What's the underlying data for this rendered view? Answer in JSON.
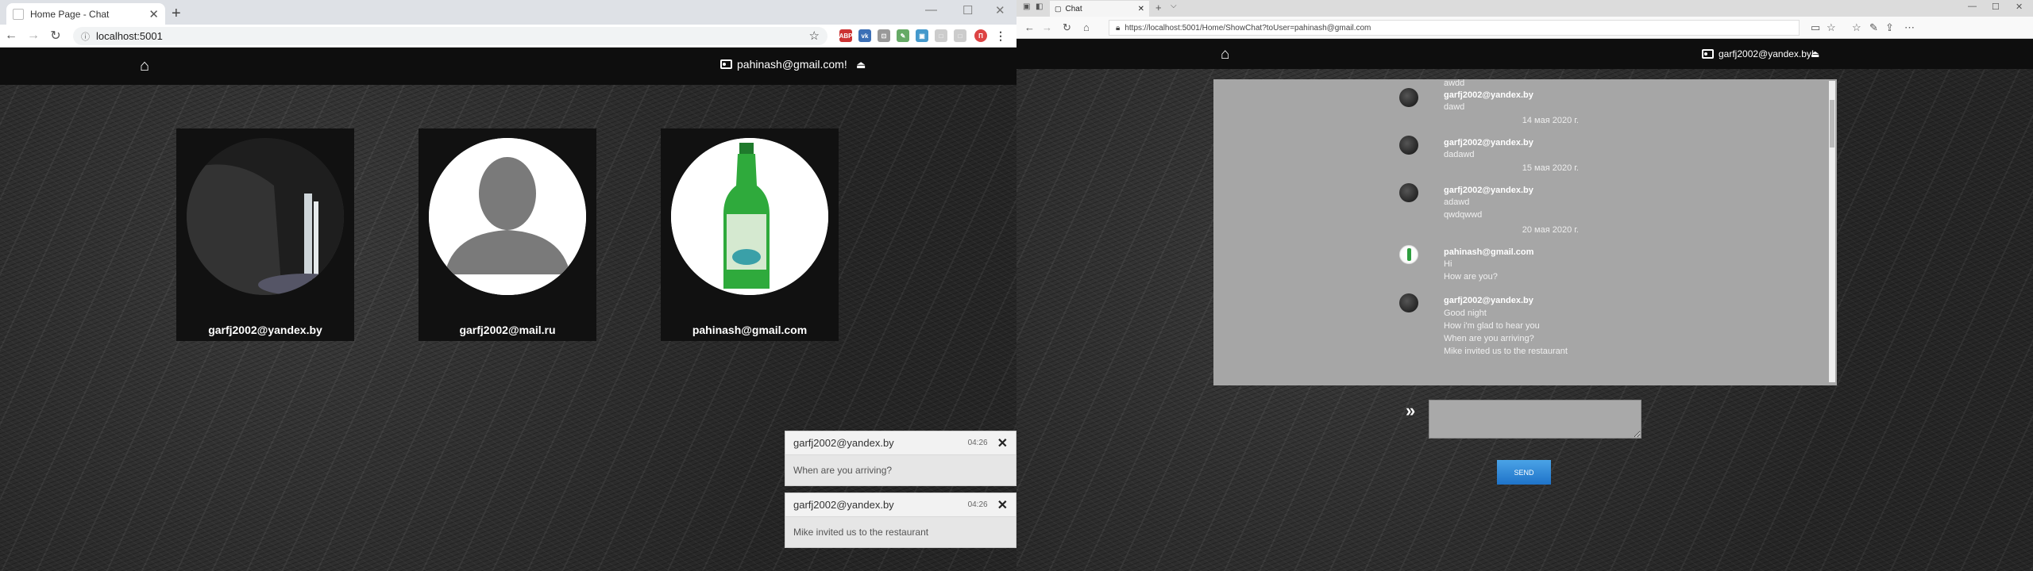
{
  "left_window": {
    "tab": {
      "title": "Home Page - Chat"
    },
    "address": {
      "url": "localhost:5001"
    },
    "navbar": {
      "home_icon": "home-icon",
      "greeting": "pahinash@gmail.com!",
      "logout_icon": "logout-icon"
    },
    "users": [
      {
        "email": "garfj2002@yandex.by",
        "avatar": "waterfall-photo"
      },
      {
        "email": "garfj2002@mail.ru",
        "avatar": "default-person-silhouette"
      },
      {
        "email": "pahinash@gmail.com",
        "avatar": "green-bottle-photo"
      }
    ],
    "notifications": [
      {
        "sender": "garfj2002@yandex.by",
        "time": "04:26",
        "message": "When are you arriving?"
      },
      {
        "sender": "garfj2002@yandex.by",
        "time": "04:26",
        "message": "Mike invited us to the restaurant"
      }
    ]
  },
  "right_window": {
    "tab": {
      "title": "Chat"
    },
    "address": {
      "url": "https://localhost:5001/Home/ShowChat?toUser=pahinash@gmail.com"
    },
    "navbar": {
      "greeting": "garfj2002@yandex.by!"
    },
    "chat": {
      "partial_top": "awdd",
      "messages": [
        {
          "sender": "garfj2002@yandex.by",
          "lines": [
            "dawd"
          ],
          "date_after": "14 мая 2020 г."
        },
        {
          "sender": "garfj2002@yandex.by",
          "lines": [
            "dadawd"
          ],
          "date_after": "15 мая 2020 г."
        },
        {
          "sender": "garfj2002@yandex.by",
          "lines": [
            "adawd",
            "qwdqwwd"
          ],
          "date_after": "20 мая 2020 г."
        },
        {
          "sender": "pahinash@gmail.com",
          "lines": [
            "Hi",
            "How are you?"
          ]
        },
        {
          "sender": "garfj2002@yandex.by",
          "lines": [
            "Good night",
            "How i'm glad to hear you",
            "When are you arriving?",
            "Mike invited us to the restaurant"
          ]
        }
      ]
    },
    "composer": {
      "input_value": "",
      "send_label": "SEND"
    }
  }
}
